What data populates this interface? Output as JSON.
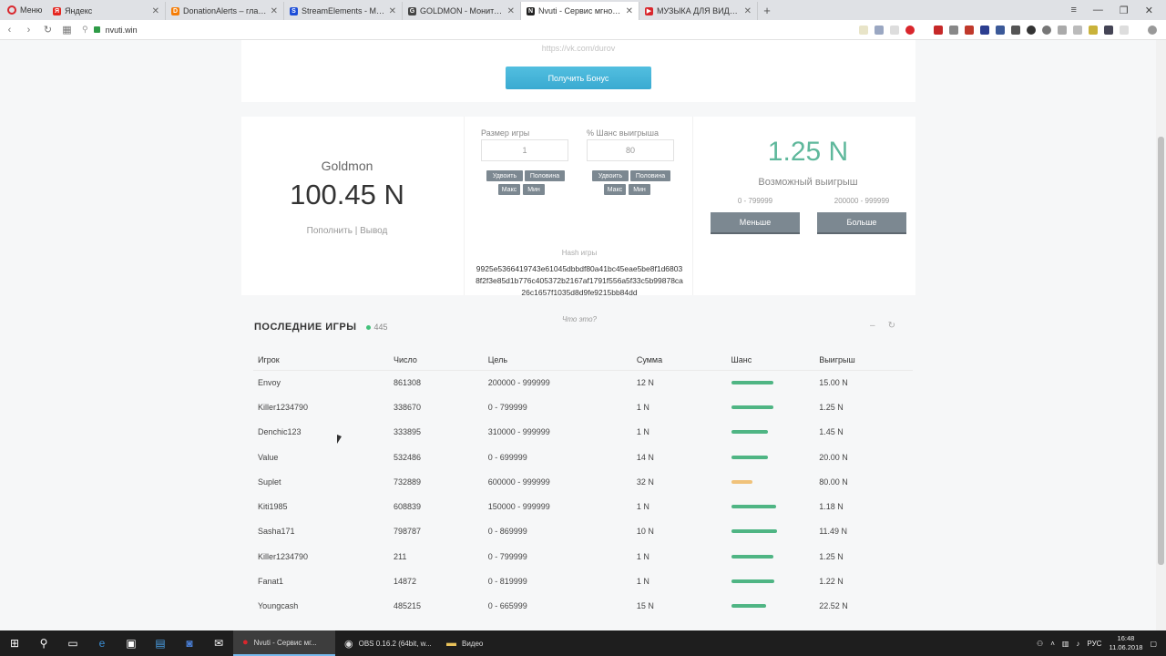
{
  "browser": {
    "menu_label": "Меню",
    "tabs": [
      {
        "title": "Яндекс",
        "favicon": "yandex-icon",
        "color": "#e52620",
        "glyph": "Я",
        "active": false
      },
      {
        "title": "DonationAlerts – главный",
        "favicon": "donationalerts-icon",
        "color": "#f57d07",
        "glyph": "D",
        "active": false
      },
      {
        "title": "StreamElements - My das",
        "favicon": "streamelements-icon",
        "color": "#1d4ed8",
        "glyph": "S",
        "active": false
      },
      {
        "title": "GOLDMON - Мониторинг",
        "favicon": "goldmon-icon",
        "color": "#444444",
        "glyph": "G",
        "active": false
      },
      {
        "title": "Nvuti - Сервис мгновенн",
        "favicon": "nvuti-icon",
        "color": "#222222",
        "glyph": "N",
        "active": true
      },
      {
        "title": "МУЗЫКА ДЛЯ ВИДЕО/АТ",
        "favicon": "youtube-icon",
        "color": "#d9262c",
        "glyph": "▶",
        "active": false
      }
    ],
    "new_tab": "+",
    "url": "nvuti.win"
  },
  "bonus": {
    "vk_placeholder": "https://vk.com/durov",
    "button_label": "Получить Бонус"
  },
  "account": {
    "username": "Goldmon",
    "balance": "100.45 N",
    "deposit_label": "Пополнить",
    "separator": "|",
    "withdraw_label": "Вывод"
  },
  "game": {
    "bet_label": "Размер игры",
    "bet_value": "1",
    "chance_label": "% Шанс выигрыша",
    "chance_value": "80",
    "double_label": "Удвоить",
    "half_label": "Половина",
    "max_label": "Макс",
    "min_label": "Мин",
    "hash_label": "Hash игры",
    "hash_value": "9925e5366419743e61045dbbdf80a41bc45eae5be8f1d68038f2f3e85d1b776c405372b2167af1791f556a5f33c5b99878ca26c1657f1035d8d9fe9215bb84dd",
    "what_is": "Что это?",
    "possible_win": "1.25 N",
    "possible_win_label": "Возможный выигрыш",
    "low_range": "0 - 799999",
    "high_range": "200000 - 999999",
    "low_button": "Меньше",
    "high_button": "Больше"
  },
  "last_games": {
    "title": "ПОСЛЕДНИЕ ИГРЫ",
    "online_count": "445",
    "columns": [
      "Игрок",
      "Число",
      "Цель",
      "Сумма",
      "Шанс",
      "Выигрыш"
    ],
    "rows": [
      {
        "player": "Envoy",
        "number": "861308",
        "target": "200000 - 999999",
        "amount": "12 N",
        "chance": 80,
        "payout": "15.00 N"
      },
      {
        "player": "Killer1234790",
        "number": "338670",
        "target": "0 - 799999",
        "amount": "1 N",
        "chance": 80,
        "payout": "1.25 N"
      },
      {
        "player": "Denchic123",
        "number": "333895",
        "target": "310000 - 999999",
        "amount": "1 N",
        "chance": 69,
        "payout": "1.45 N"
      },
      {
        "player": "Value",
        "number": "532486",
        "target": "0 - 699999",
        "amount": "14 N",
        "chance": 70,
        "payout": "20.00 N"
      },
      {
        "player": "Suplet",
        "number": "732889",
        "target": "600000 - 999999",
        "amount": "32 N",
        "chance": 40,
        "payout": "80.00 N"
      },
      {
        "player": "Kiti1985",
        "number": "608839",
        "target": "150000 - 999999",
        "amount": "1 N",
        "chance": 85,
        "payout": "1.18 N"
      },
      {
        "player": "Sasha171",
        "number": "798787",
        "target": "0 - 869999",
        "amount": "10 N",
        "chance": 87,
        "payout": "11.49 N"
      },
      {
        "player": "Killer1234790",
        "number": "211",
        "target": "0 - 799999",
        "amount": "1 N",
        "chance": 80,
        "payout": "1.25 N"
      },
      {
        "player": "Fanat1",
        "number": "14872",
        "target": "0 - 819999",
        "amount": "1 N",
        "chance": 82,
        "payout": "1.22 N"
      },
      {
        "player": "Youngcash",
        "number": "485215",
        "target": "0 - 665999",
        "amount": "15 N",
        "chance": 67,
        "payout": "22.52 N"
      }
    ]
  },
  "colors": {
    "accent_green": "#5fb89c",
    "bar_green": "#4fb584",
    "bar_low": "#f0c27a",
    "button_gray": "#7c8891"
  },
  "taskbar": {
    "tasks": [
      {
        "label": "Nvuti - Сервис мг...",
        "icon": "opera-icon",
        "active": true
      },
      {
        "label": "OBS 0.16.2 (64bit, w...",
        "icon": "obs-icon",
        "active": false
      },
      {
        "label": "Видео",
        "icon": "folder-icon",
        "active": false
      }
    ],
    "language": "РУС",
    "time": "16:48",
    "date": "11.06.2018"
  }
}
